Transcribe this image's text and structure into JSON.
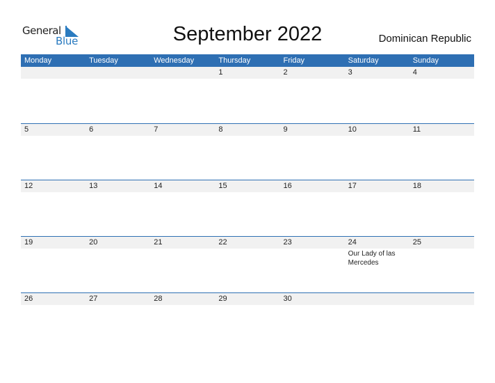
{
  "brand": {
    "general": "General",
    "blue": "Blue",
    "accent_color": "#2e6fb3",
    "logo_icon": "triangle-flag-icon"
  },
  "header": {
    "title": "September 2022",
    "country": "Dominican Republic"
  },
  "weekdays": [
    "Monday",
    "Tuesday",
    "Wednesday",
    "Thursday",
    "Friday",
    "Saturday",
    "Sunday"
  ],
  "weeks": [
    [
      {
        "day": ""
      },
      {
        "day": ""
      },
      {
        "day": ""
      },
      {
        "day": "1"
      },
      {
        "day": "2"
      },
      {
        "day": "3"
      },
      {
        "day": "4"
      }
    ],
    [
      {
        "day": "5"
      },
      {
        "day": "6"
      },
      {
        "day": "7"
      },
      {
        "day": "8"
      },
      {
        "day": "9"
      },
      {
        "day": "10"
      },
      {
        "day": "11"
      }
    ],
    [
      {
        "day": "12"
      },
      {
        "day": "13"
      },
      {
        "day": "14"
      },
      {
        "day": "15"
      },
      {
        "day": "16"
      },
      {
        "day": "17"
      },
      {
        "day": "18"
      }
    ],
    [
      {
        "day": "19"
      },
      {
        "day": "20"
      },
      {
        "day": "21"
      },
      {
        "day": "22"
      },
      {
        "day": "23"
      },
      {
        "day": "24",
        "event": "Our Lady of las Mercedes"
      },
      {
        "day": "25"
      }
    ],
    [
      {
        "day": "26"
      },
      {
        "day": "27"
      },
      {
        "day": "28"
      },
      {
        "day": "29"
      },
      {
        "day": "30"
      },
      {
        "day": ""
      },
      {
        "day": ""
      }
    ]
  ]
}
